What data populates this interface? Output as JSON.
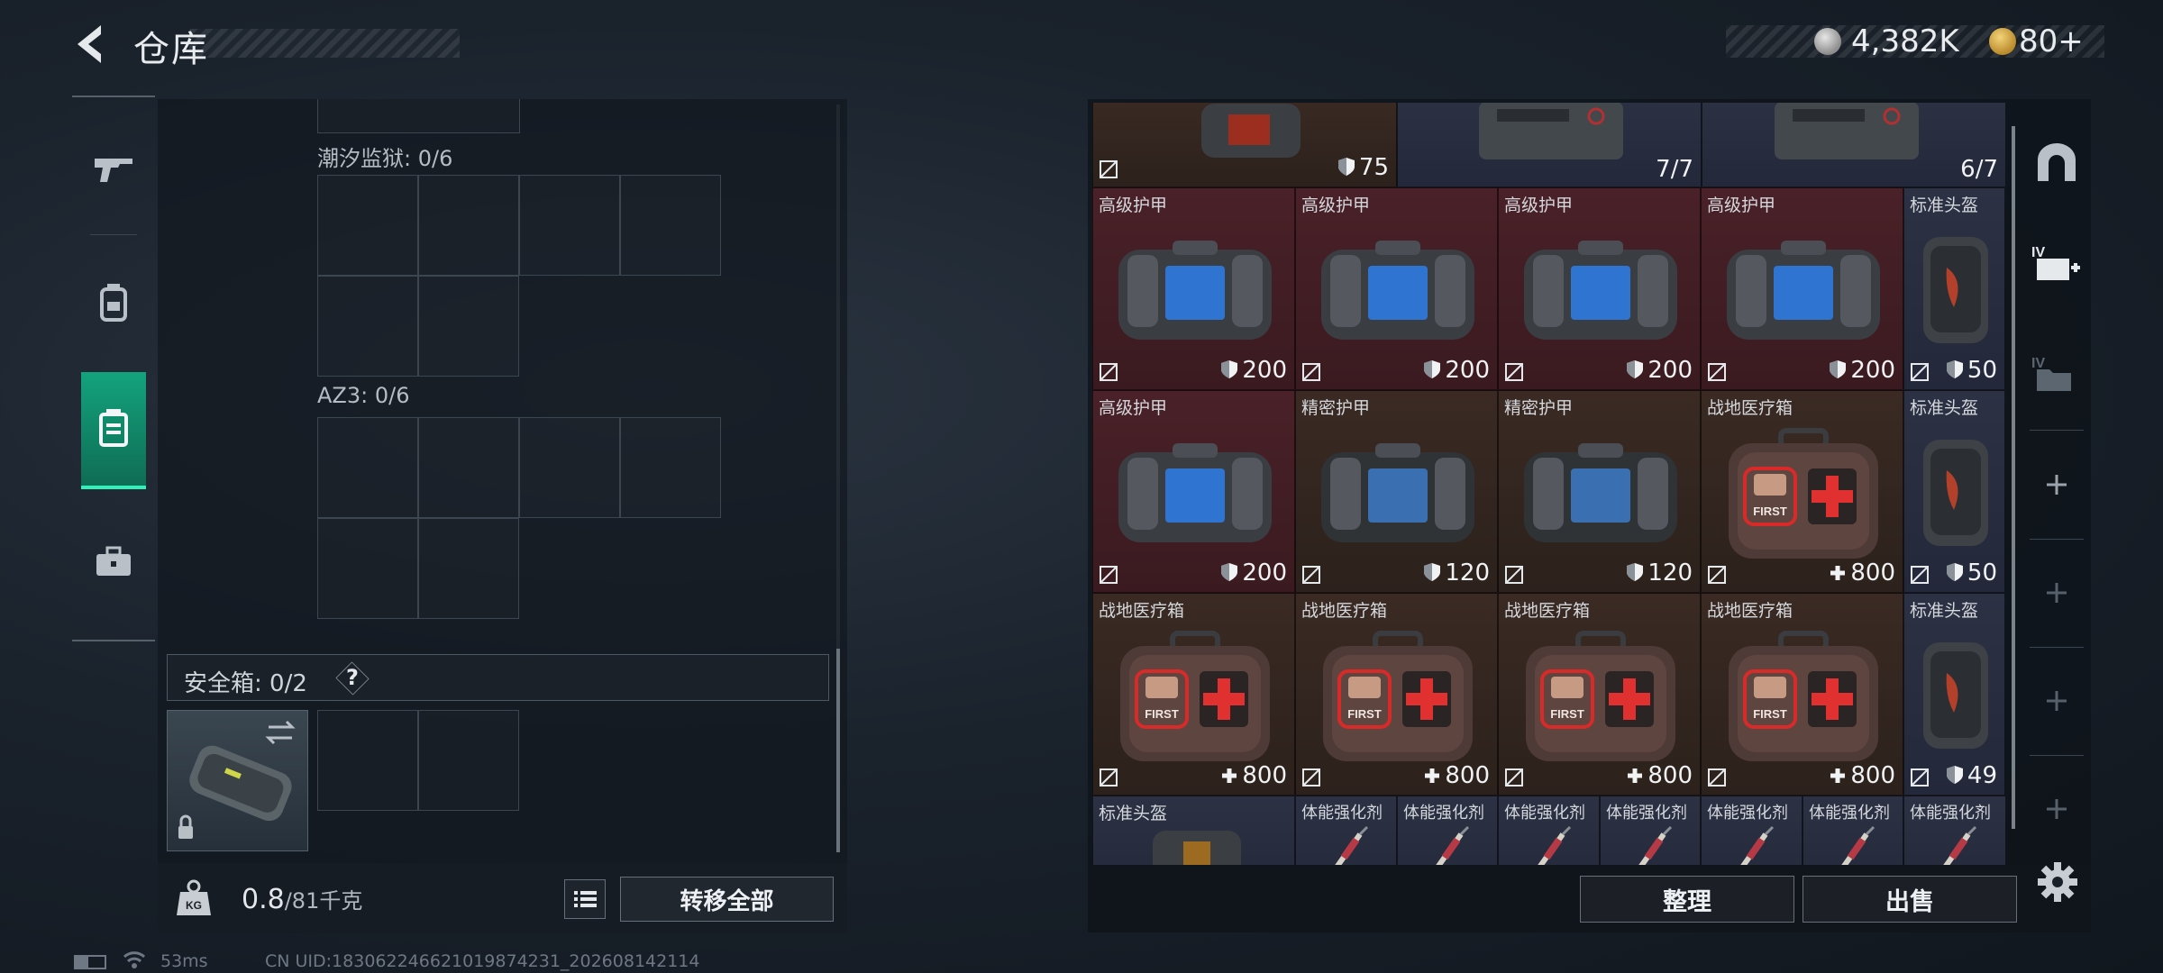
{
  "header": {
    "title": "仓库",
    "silver_amount": "4,382K",
    "gold_amount": "80+"
  },
  "left_panel": {
    "groups": [
      {
        "label": "潮汐监狱: 0/6"
      },
      {
        "label": "AZ3: 0/6"
      }
    ],
    "safe_box_label": "安全箱: 0/2",
    "help_symbol": "?",
    "weight_current": "0.8",
    "weight_max": "/81千克",
    "transfer_all_label": "转移全部"
  },
  "status_bar": {
    "ping": "53ms",
    "uid": "CN UID:1830622466210198742​31_202608142114"
  },
  "inventory": {
    "top_row": [
      {
        "value": "75",
        "icon": "shield-icon",
        "color": "brown",
        "nosell": true
      },
      {
        "value": "7/7",
        "icon": "",
        "color": "navy",
        "nosell": false
      },
      {
        "value": "6/7",
        "icon": "",
        "color": "navy",
        "nosell": false
      }
    ],
    "rows": [
      [
        {
          "name": "高级护甲",
          "value": "200",
          "icon": "shield-icon",
          "color": "red",
          "kind": "armor-blue"
        },
        {
          "name": "高级护甲",
          "value": "200",
          "icon": "shield-icon",
          "color": "red",
          "kind": "armor-blue"
        },
        {
          "name": "高级护甲",
          "value": "200",
          "icon": "shield-icon",
          "color": "red",
          "kind": "armor-blue"
        },
        {
          "name": "高级护甲",
          "value": "200",
          "icon": "shield-icon",
          "color": "red",
          "kind": "armor-blue"
        },
        {
          "name": "标准头盔",
          "value": "50",
          "icon": "shield-icon",
          "color": "navy",
          "kind": "helmet"
        }
      ],
      [
        {
          "name": "高级护甲",
          "value": "200",
          "icon": "shield-icon",
          "color": "red",
          "kind": "armor-blue"
        },
        {
          "name": "精密护甲",
          "value": "120",
          "icon": "shield-icon",
          "color": "brown",
          "kind": "armor-grey"
        },
        {
          "name": "精密护甲",
          "value": "120",
          "icon": "shield-icon",
          "color": "brown",
          "kind": "armor-grey"
        },
        {
          "name": "战地医疗箱",
          "value": "800",
          "icon": "plus-icon",
          "color": "brown",
          "kind": "medkit"
        },
        {
          "name": "标准头盔",
          "value": "50",
          "icon": "shield-icon",
          "color": "navy",
          "kind": "helmet"
        }
      ],
      [
        {
          "name": "战地医疗箱",
          "value": "800",
          "icon": "plus-icon",
          "color": "brown",
          "kind": "medkit"
        },
        {
          "name": "战地医疗箱",
          "value": "800",
          "icon": "plus-icon",
          "color": "brown",
          "kind": "medkit"
        },
        {
          "name": "战地医疗箱",
          "value": "800",
          "icon": "plus-icon",
          "color": "brown",
          "kind": "medkit"
        },
        {
          "name": "战地医疗箱",
          "value": "800",
          "icon": "plus-icon",
          "color": "brown",
          "kind": "medkit"
        },
        {
          "name": "标准头盔",
          "value": "49",
          "icon": "shield-icon",
          "color": "navy",
          "kind": "helmet"
        }
      ]
    ],
    "bottom_row": [
      {
        "name": "标准头盔"
      },
      {
        "name": "体能强化剂"
      },
      {
        "name": "体能强化剂"
      },
      {
        "name": "体能强化剂"
      },
      {
        "name": "体能强化剂"
      },
      {
        "name": "体能强化剂"
      },
      {
        "name": "体能强化剂"
      },
      {
        "name": "体能强化剂"
      }
    ]
  },
  "actions": {
    "organize_label": "整理",
    "sell_label": "出售"
  },
  "colors": {
    "accent": "#13a37c",
    "cell_red": "#4a2128",
    "cell_brown": "#3a2a23",
    "cell_navy": "#2c3144"
  }
}
